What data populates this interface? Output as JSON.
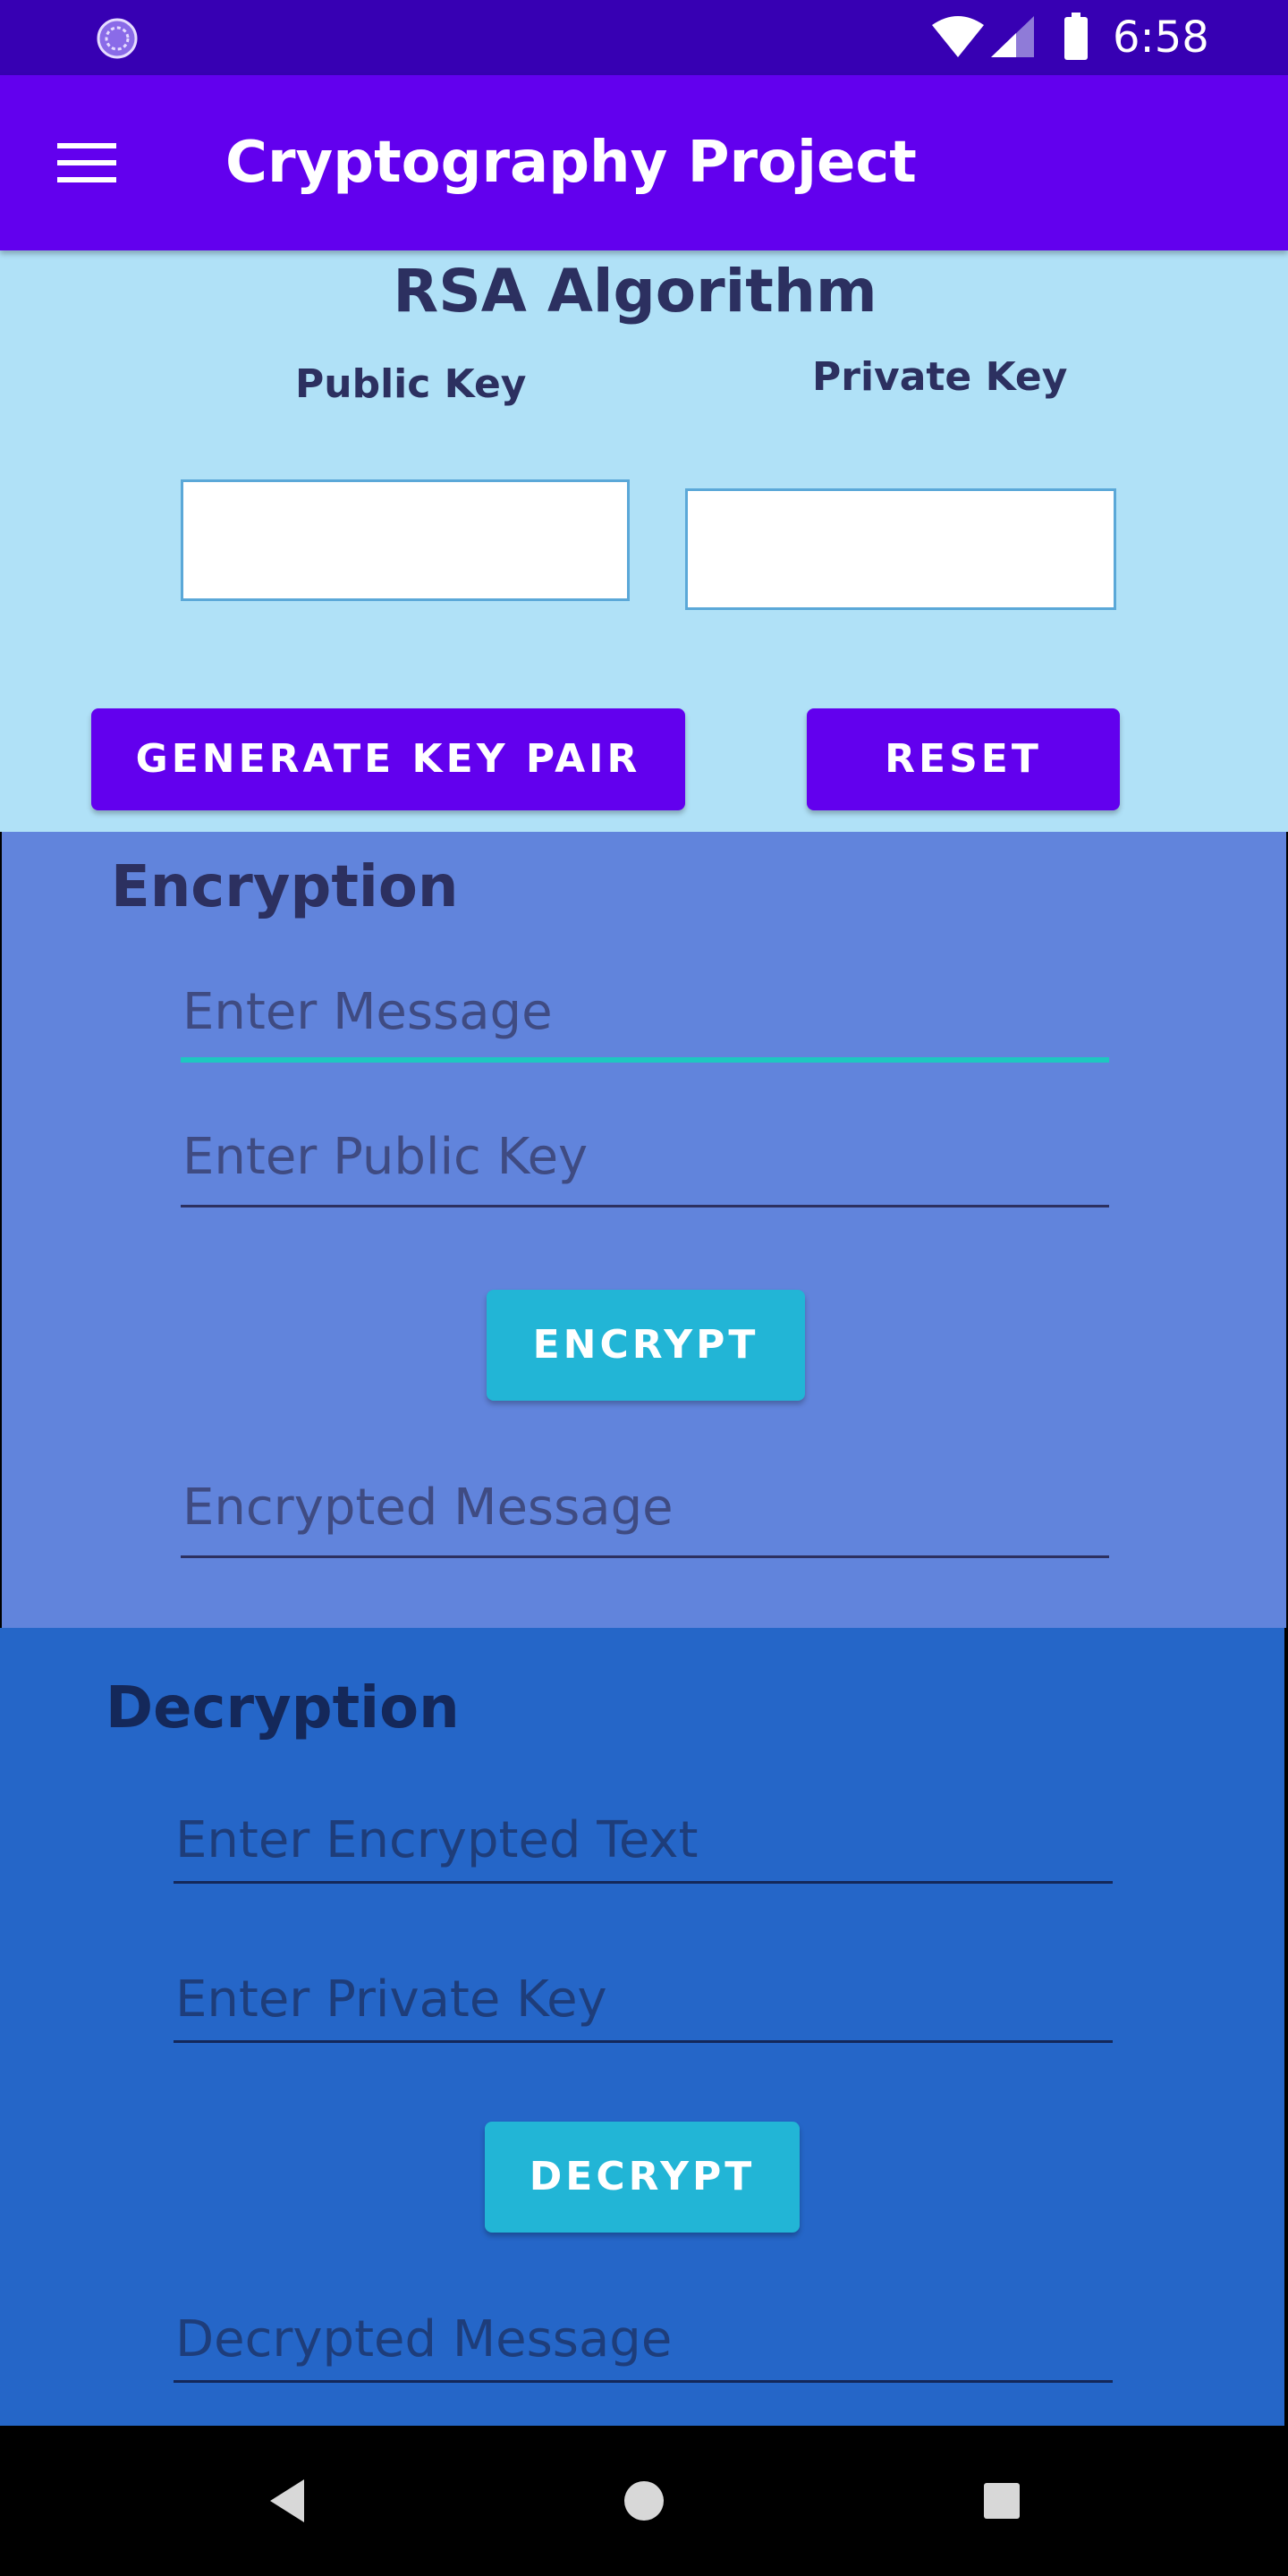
{
  "status_bar": {
    "time": "6:58",
    "icons": [
      "app-logo-icon",
      "wifi-icon",
      "signal-icon",
      "battery-icon"
    ]
  },
  "app_bar": {
    "title": "Cryptography Project",
    "menu_icon": "menu-icon"
  },
  "rsa": {
    "title": "RSA Algorithm",
    "public_key_label": "Public Key",
    "private_key_label": "Private Key",
    "public_key_value": "",
    "private_key_value": "",
    "generate_button": "GENERATE KEY PAIR",
    "reset_button": "RESET"
  },
  "encryption": {
    "title": "Encryption",
    "message_placeholder": "Enter Message",
    "public_key_placeholder": "Enter Public Key",
    "encrypt_button": "ENCRYPT",
    "encrypted_message_placeholder": "Encrypted Message"
  },
  "decryption": {
    "title": "Decryption",
    "encrypted_text_placeholder": "Enter Encrypted Text",
    "private_key_placeholder": "Enter Private Key",
    "decrypt_button": "DECRYPT",
    "decrypted_message_placeholder": "Decrypted Message"
  },
  "nav_bar": {
    "icons": [
      "back-icon",
      "home-icon",
      "recents-icon"
    ]
  },
  "colors": {
    "status_bar": "#3700B3",
    "app_bar": "#6200EE",
    "rsa_bg": "#B0E1F7",
    "encryption_bg": "#6184DC",
    "decryption_bg": "#2566C8",
    "action_button": "#22B5D6",
    "focus_underline": "#1DC8C0"
  }
}
